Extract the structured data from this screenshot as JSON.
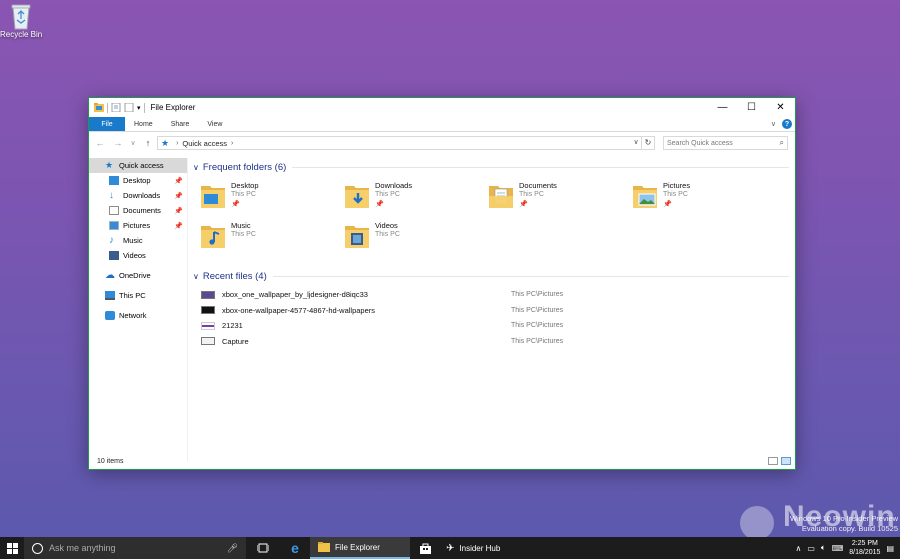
{
  "desktop": {
    "recycle_bin_label": "Recycle Bin"
  },
  "window": {
    "title": "File Explorer",
    "ribbon_tabs": [
      "File",
      "Home",
      "Share",
      "View"
    ],
    "address": {
      "location": "Quick access"
    },
    "search_placeholder": "Search Quick access",
    "sidebar": [
      {
        "label": "Quick access",
        "pinned": false,
        "selected": true,
        "icon": "star-icon",
        "color": "#1979ca"
      },
      {
        "label": "Desktop",
        "pinned": true,
        "icon": "desktop-folder-icon",
        "color": "#2e8bd8"
      },
      {
        "label": "Downloads",
        "pinned": true,
        "icon": "download-arrow-icon",
        "color": "#2e8bd8"
      },
      {
        "label": "Documents",
        "pinned": true,
        "icon": "documents-icon",
        "color": "#8c8c8c"
      },
      {
        "label": "Pictures",
        "pinned": true,
        "icon": "pictures-icon",
        "color": "#3c8ad6"
      },
      {
        "label": "Music",
        "pinned": false,
        "icon": "music-note-icon",
        "color": "#2e8bd8"
      },
      {
        "label": "Videos",
        "pinned": false,
        "icon": "videos-icon",
        "color": "#3a5c8c"
      },
      {
        "label": "OneDrive",
        "pinned": false,
        "icon": "cloud-icon",
        "color": "#1f6fc4"
      },
      {
        "label": "This PC",
        "pinned": false,
        "icon": "computer-icon",
        "color": "#2e8bd8"
      },
      {
        "label": "Network",
        "pinned": false,
        "icon": "network-icon",
        "color": "#2e8bd8"
      }
    ],
    "frequent_header": "Frequent folders (6)",
    "folders": [
      {
        "name": "Desktop",
        "sub": "This PC",
        "pinned": true,
        "badge": "desktop"
      },
      {
        "name": "Downloads",
        "sub": "This PC",
        "pinned": true,
        "badge": "download"
      },
      {
        "name": "Documents",
        "sub": "This PC",
        "pinned": true,
        "badge": "doc"
      },
      {
        "name": "Pictures",
        "sub": "This PC",
        "pinned": true,
        "badge": "pic"
      },
      {
        "name": "Music",
        "sub": "This PC",
        "pinned": false,
        "badge": "music"
      },
      {
        "name": "Videos",
        "sub": "This PC",
        "pinned": false,
        "badge": "video"
      }
    ],
    "recent_header": "Recent files (4)",
    "recent_files": [
      {
        "name": "xbox_one_wallpaper_by_ljdesigner-d8iqc33",
        "location": "This PC\\Pictures",
        "thumb_color": "#5b4a8f"
      },
      {
        "name": "xbox-one-wallpaper-4577-4867-hd-wallpapers",
        "location": "This PC\\Pictures",
        "thumb_color": "#111111"
      },
      {
        "name": "21231",
        "location": "This PC\\Pictures",
        "thumb_color": "#7a3fa6"
      },
      {
        "name": "Capture",
        "location": "This PC\\Pictures",
        "thumb_color": "#f2f2f2"
      }
    ],
    "status": "10 items"
  },
  "watermark": {
    "line1": "Windows 10 Pro Insider Preview",
    "line2": "Evaluation copy. Build 10525",
    "brand": "Neowin"
  },
  "taskbar": {
    "search_placeholder": "Ask me anything",
    "apps": [
      {
        "label": "File Explorer",
        "active": true
      },
      {
        "label": "Insider Hub",
        "active": false
      }
    ],
    "time": "2:25 PM",
    "date": "8/18/2015"
  }
}
